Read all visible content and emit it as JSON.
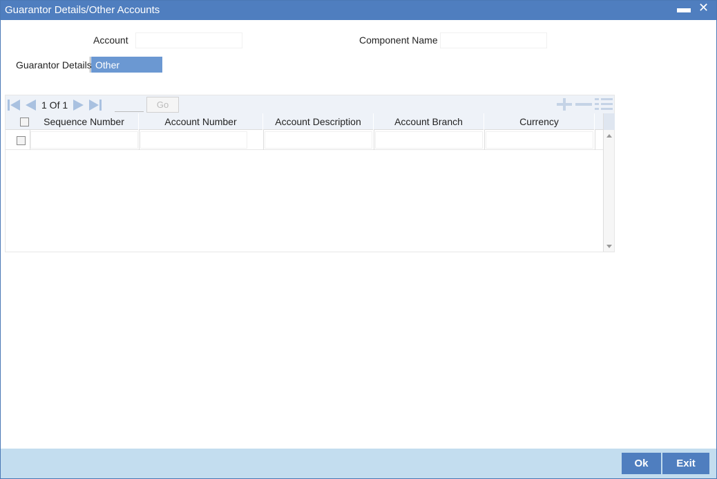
{
  "window": {
    "title": "Guarantor Details/Other Accounts",
    "minimize_label": "▬",
    "close_label": "✕"
  },
  "form": {
    "account_label": "Account",
    "account_value": "",
    "component_label": "Component Name",
    "component_value": ""
  },
  "tabs": [
    {
      "label": "Guarantor Details",
      "active": false
    },
    {
      "label": "Other Accounts",
      "active": true
    }
  ],
  "grid": {
    "pager_text": "1 Of 1",
    "page_input_value": "",
    "go_label": "Go",
    "columns": [
      "Sequence Number",
      "Account Number",
      "Account Description",
      "Account Branch",
      "Currency"
    ],
    "rows": [
      {
        "sequence_number": "",
        "account_number": "",
        "account_description": "",
        "account_branch": "",
        "currency": ""
      }
    ]
  },
  "footer": {
    "ok_label": "Ok",
    "exit_label": "Exit"
  },
  "colors": {
    "titlebar": "#4f7ebf",
    "active_tab": "#6b98d2",
    "footer": "#c3ddef",
    "button": "#4f7ebf"
  }
}
